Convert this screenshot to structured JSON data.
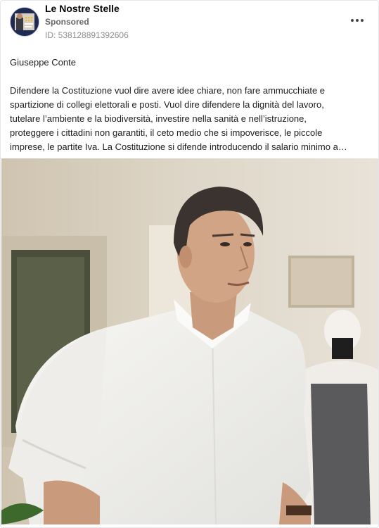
{
  "ad": {
    "page_name": "Le Nostre Stelle",
    "sponsored_label": "Sponsored",
    "id_text": "ID: 538128891392606",
    "author": "Giuseppe Conte",
    "body_lines": [
      "Difendere la Costituzione vuol dire avere idee chiare, non fare ammucchiate e",
      "spartizione di collegi elettorali e posti. Vuol dire difendere la dignità del lavoro,",
      "tutelare l’ambiente e la biodiversità, investire nella sanità e nell’istruzione,",
      "proteggere i cittadini non garantiti, il ceto medio che si impoverisce, le piccole",
      "imprese, le partite Iva. La Costituzione si difende introducendo il salario minimo a…"
    ]
  },
  "icons": {
    "avatar": "page-logo",
    "more": "more-options-icon"
  },
  "colors": {
    "text_primary": "#1c1e21",
    "text_secondary": "#65676b",
    "border": "#e4e6eb"
  }
}
